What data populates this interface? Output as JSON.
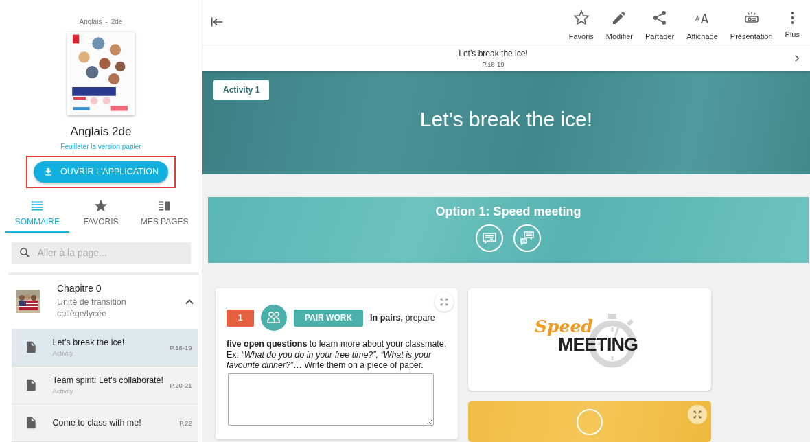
{
  "breadcrumb": {
    "items": [
      {
        "label": "Anglais"
      },
      {
        "label": "2de"
      }
    ],
    "separator": "-"
  },
  "book": {
    "title": "Anglais 2de",
    "link": "Feuilleter la version papier",
    "button": "OUVRIR L'APPLICATION",
    "highlighted": true
  },
  "sidebar_tabs": [
    {
      "label": "SOMMAIRE",
      "selected": true
    },
    {
      "label": "FAVORIS",
      "selected": false
    },
    {
      "label": "MES PAGES",
      "selected": false
    }
  ],
  "search": {
    "placeholder": "Aller à la page..."
  },
  "chapter": {
    "title": "Chapitre 0",
    "subtitle": "Unité de transition collège/lycée",
    "expanded": true,
    "items": [
      {
        "title": "Let’s break the ice!",
        "type": "Activity",
        "pages": "P.18-19",
        "selected": true
      },
      {
        "title": "Team spirit: Let's collaborate!",
        "type": "Activity",
        "pages": "P.20-21",
        "selected": false
      },
      {
        "title": "Come to class with me!",
        "pages": "P.22",
        "selected": false
      }
    ]
  },
  "toolbar": {
    "actions": [
      {
        "label": "Favoris"
      },
      {
        "label": "Modifier"
      },
      {
        "label": "Partager"
      },
      {
        "label": "Affichage"
      },
      {
        "label": "Présentation"
      },
      {
        "label": "Plus"
      }
    ]
  },
  "page_header": {
    "title": "Let’s break the ice!",
    "pages": "P.18-19"
  },
  "hero": {
    "badge": "Activity 1",
    "title": "Let’s break the ice!"
  },
  "option": {
    "title": "Option 1: Speed meeting"
  },
  "exercise": {
    "number": "1",
    "tag": "PAIR WORK",
    "instruction": "**In pairs,** prepare",
    "text": "**five open questions** to learn more about your classmate. Ex: *“What do you do in your free time?”, “What is your favourite dinner?”*… Write them on a piece of paper."
  },
  "logo": {
    "script": "Speed",
    "bold": "MEETING"
  }
}
